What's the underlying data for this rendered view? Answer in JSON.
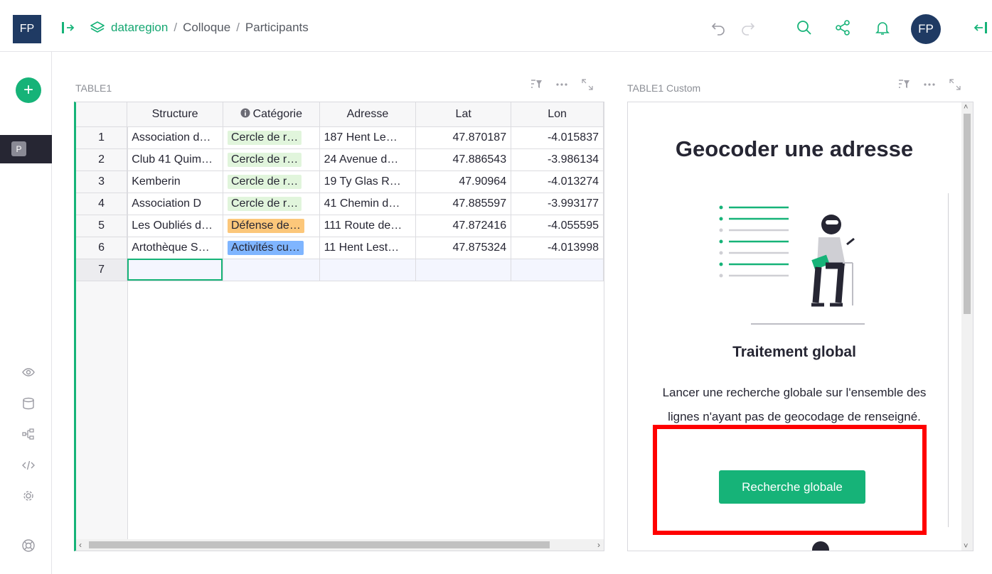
{
  "header": {
    "logo_initials": "FP",
    "breadcrumb": {
      "org": "dataregion",
      "sep1": "/",
      "doc": "Colloque",
      "sep2": "/",
      "page": "Participants"
    },
    "avatar_initials": "FP"
  },
  "rail": {
    "add_label": "+",
    "page_badge": "P"
  },
  "left_section": {
    "title": "TABLE1",
    "columns": [
      "Structure",
      "Catégorie",
      "Adresse",
      "Lat",
      "Lon"
    ],
    "rows": [
      {
        "n": "1",
        "structure": "Association d…",
        "categorie": "Cercle de r…",
        "adresse": "187 Hent Le…",
        "lat": "47.870187",
        "lon": "-4.015837",
        "cat_color": "#e1f5dc"
      },
      {
        "n": "2",
        "structure": "Club 41 Quim…",
        "categorie": "Cercle de r…",
        "adresse": "24 Avenue d…",
        "lat": "47.886543",
        "lon": "-3.986134",
        "cat_color": "#e1f5dc"
      },
      {
        "n": "3",
        "structure": "Kemberin",
        "categorie": "Cercle de r…",
        "adresse": "19 Ty Glas R…",
        "lat": "47.90964",
        "lon": "-4.013274",
        "cat_color": "#e1f5dc"
      },
      {
        "n": "4",
        "structure": "Association D",
        "categorie": "Cercle de r…",
        "adresse": "41 Chemin d…",
        "lat": "47.885597",
        "lon": "-3.993177",
        "cat_color": "#e1f5dc"
      },
      {
        "n": "5",
        "structure": "Les Oubliés d…",
        "categorie": "Défense de…",
        "adresse": "111 Route de…",
        "lat": "47.872416",
        "lon": "-4.055595",
        "cat_color": "#fcc77a"
      },
      {
        "n": "6",
        "structure": "Artothèque S…",
        "categorie": "Activités cu…",
        "adresse": "11 Hent Lest…",
        "lat": "47.875324",
        "lon": "-4.013998",
        "cat_color": "#7fb5ff"
      }
    ],
    "new_row_number": "7"
  },
  "right_section": {
    "title": "TABLE1 Custom",
    "heading": "Geocoder une adresse",
    "subheading": "Traitement global",
    "description": "Lancer une recherche globale sur l'ensemble des lignes n'ayant pas de geocodage de renseigné.",
    "button_label": "Recherche globale"
  },
  "colors": {
    "accent": "#16b378",
    "brand_dark": "#1f3a63",
    "highlight": "#ff0000"
  }
}
